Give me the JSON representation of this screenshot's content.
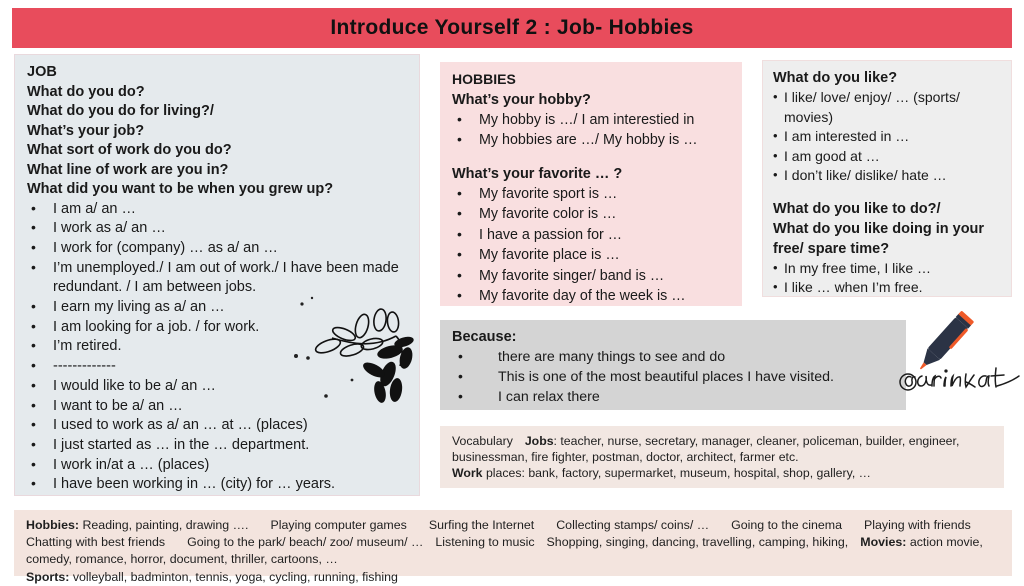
{
  "header": {
    "title": "Introduce Yourself  2  : Job- Hobbies",
    "bg_color": "#e84c5c"
  },
  "job_box": {
    "bg_color": "#e5eaed",
    "title": "JOB",
    "questions": [
      "What do you do?",
      " What do you do for living?/",
      "What’s your job?",
      "What sort of work do you do?",
      "What line of work are you in?",
      "What did you want to be when you grew up?"
    ],
    "answers": [
      "I am a/ an …",
      "I work as a/ an …",
      "I work for (company) … as a/ an …",
      "I’m unemployed./ I am out of work./ I have been made redundant. / I am between jobs.",
      "I earn my living as a/ an …",
      "I am looking for a job. / for work.",
      "I’m retired.",
      "-------------",
      "I would like to be a/ an …",
      "I want to be a/ an …",
      "I used to work as a/ an … at … (places)",
      "I just started as … in the … department.",
      "I work in/at a … (places)",
      "I have been working in … (city) for … years."
    ]
  },
  "hobbies_box": {
    "bg_color": "#f9dfe0",
    "title": "HOBBIES",
    "question1": "What’s your hobby?",
    "answers1": [
      "My hobby is …/ I am interestied in",
      "My hobbies are …/ My hobby is …"
    ],
    "question2": "What’s your favorite … ?",
    "answers2": [
      "My favorite sport is …",
      "My favorite color is …",
      "I have a passion for …",
      "My favorite place is …",
      "My favorite singer/ band is …",
      "My favorite day of the week is …"
    ]
  },
  "like_box": {
    "bg_color": "#eeeeee",
    "question1": "What do you like?",
    "answers1": [
      "I like/ love/ enjoy/ … (sports/ movies)",
      "I am interested in …",
      "I am good at …",
      "I don’t like/ dislike/ hate …"
    ],
    "question2_line1": "What do you like to do?/",
    "question2_line2": "What do you like doing in your",
    "question2_line3": "free/ spare time?",
    "answers2": [
      "In my free time, I like …",
      "I like … when I’m free."
    ]
  },
  "because_box": {
    "bg_color": "#d4d4d4",
    "title": "Because:",
    "items": [
      "there are many things to see and do",
      "This is one of the most beautiful places I have visited.",
      "I can relax there"
    ]
  },
  "vocab_box": {
    "bg_color": "#f2e7e2",
    "label": "Vocabulary",
    "jobs_label": "Jobs",
    "jobs_list": ": teacher, nurse, secretary, manager, cleaner, policeman, builder, engineer, businessman, fire fighter, postman, doctor, architect, farmer etc.",
    "work_label_bold": "Work",
    "work_label_rest": " places",
    "work_list": ": bank, factory, supermarket,  museum, hospital, shop, gallery, …"
  },
  "bottom_bar": {
    "bg_color": "#f3e4de",
    "hobbies_label": "Hobbies:",
    "line1_a": " Reading, painting, drawing  ….",
    "line1_b": "Playing computer games",
    "line1_c": "Surfing the Internet",
    "line1_d": "Collecting stamps/ coins/ …",
    "line1_e": "Going to the cinema",
    "line1_f": "Playing with friends",
    "line2_a": "Chatting with best friends",
    "line2_b": "Going to the park/ beach/ zoo/ museum/ …",
    "line2_c": "Listening to music",
    "line2_d": "Shopping, singing, dancing, travelling, camping, hiking,",
    "movies_label": "Movies:",
    "movies_list": " action movie, comedy, romance, horror, document, thriller, cartoons, …",
    "sports_label": "Sports:",
    "sports_list": " volleyball, badminton, tennis, yoga, cycling, running, fishing"
  },
  "artwork": {
    "branch": "botanical-branch-illustration",
    "pen": "pen-illustration",
    "signature": "@karinkat",
    "pen_body_color": "#2b3345",
    "pen_accent_color": "#ef5a29"
  }
}
